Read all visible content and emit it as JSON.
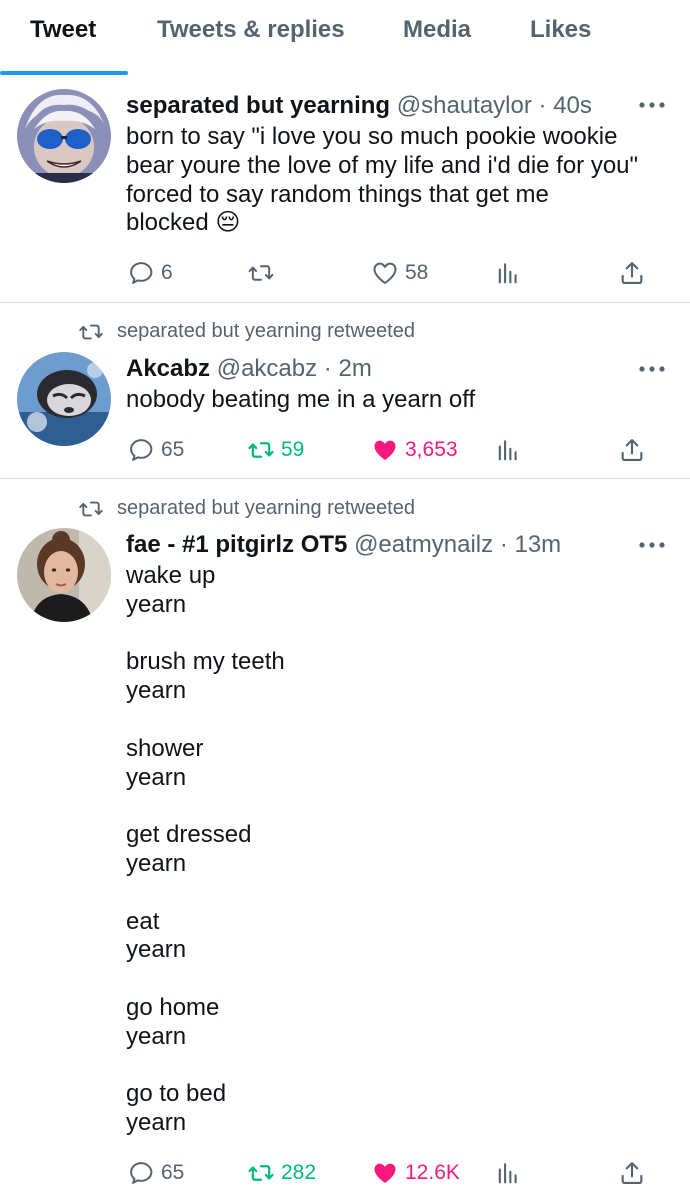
{
  "tabs": [
    "Tweet",
    "Tweets & replies",
    "Media",
    "Likes"
  ],
  "active_tab": "Tweet",
  "colors": {
    "accent": "#1d9bf0",
    "retweet_green": "#00ba7c",
    "like_pink": "#f91880",
    "secondary": "#536471"
  },
  "tweets": [
    {
      "retweeted_by": "",
      "name": "separated but yearning",
      "handle": "@shautaylor",
      "dot": "·",
      "time": "40s",
      "lines": [
        "born to say \"i love you so much pookie wookie",
        "bear youre the love of my life and i'd die for you\"",
        "forced to say random things that get me",
        "blocked 😔"
      ],
      "replies": "6",
      "retweets": "",
      "likes": "58",
      "liked": false,
      "retweeted": false
    },
    {
      "retweeted_by": "separated but yearning retweeted",
      "name": "Akcabz",
      "handle": "@akcabz",
      "dot": "·",
      "time": "2m",
      "lines": [
        "nobody beating me in a yearn off"
      ],
      "replies": "65",
      "retweets": "59",
      "likes": "3,653",
      "liked": true,
      "retweeted": true
    },
    {
      "retweeted_by": "separated but yearning retweeted",
      "name": "fae - #1 pitgirlz OT5",
      "handle": "@eatmynailz",
      "dot": "·",
      "time": "13m",
      "lines": [
        "wake up",
        "yearn",
        "",
        "brush my teeth",
        "yearn",
        "",
        "shower",
        "yearn",
        "",
        "get dressed",
        "yearn",
        "",
        "eat",
        "yearn",
        "",
        "go home",
        "yearn",
        "",
        "go to bed",
        "yearn"
      ],
      "replies": "65",
      "retweets": "282",
      "likes": "12.6K",
      "liked": true,
      "retweeted": true
    }
  ],
  "icons": {
    "reply": "reply-icon",
    "retweet": "retweet-icon",
    "like": "heart-icon",
    "views": "views-icon",
    "share": "share-icon",
    "more": "more-icon"
  }
}
